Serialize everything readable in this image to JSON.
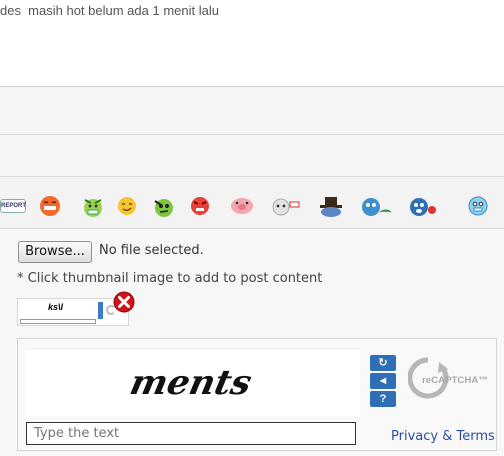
{
  "comment": {
    "text": "des  masih hot belum ada 1 menit lalu"
  },
  "emoji_bar": {
    "report_label": "REPORT",
    "emoticons": [
      "laughing-face",
      "sick-face",
      "winking-face",
      "thinking-face",
      "angry-face",
      "pig-face",
      "cloud-face",
      "top-hat-face",
      "tired-face",
      "shocked-face",
      "cold-face"
    ]
  },
  "upload": {
    "browse_label": "Browse...",
    "file_status": "No file selected.",
    "hint": "* Click thumbnail image to add to post content"
  },
  "captcha": {
    "challenge_word": "ments",
    "input_placeholder": "Type the text",
    "privacy_label": "Privacy & Terms",
    "logo_text": "reCAPTCHA™",
    "refresh_glyph": "↻",
    "audio_glyph": "◄",
    "help_glyph": "?"
  },
  "colors": {
    "link": "#2b4da1",
    "captcha_button": "#2f6fb5",
    "remove_icon": "#d0121b"
  }
}
